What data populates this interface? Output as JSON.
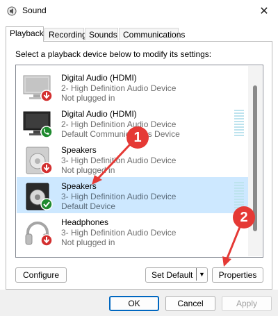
{
  "window": {
    "title": "Sound",
    "close_glyph": "✕"
  },
  "tabs": [
    {
      "label": "Playback",
      "active": true
    },
    {
      "label": "Recording",
      "active": false
    },
    {
      "label": "Sounds",
      "active": false
    },
    {
      "label": "Communications",
      "active": false
    }
  ],
  "instructions": "Select a playback device below to modify its settings:",
  "devices": [
    {
      "name": "Digital Audio (HDMI)",
      "description": "2- High Definition Audio Device",
      "status": "Not plugged in",
      "icon": "monitor-icon",
      "badge": "not-plugged-in-badge",
      "selected": false
    },
    {
      "name": "Digital Audio (HDMI)",
      "description": "2- High Definition Audio Device",
      "status": "Default Communications Device",
      "icon": "monitor-icon",
      "badge": "phone-badge",
      "selected": false
    },
    {
      "name": "Speakers",
      "description": "3- High Definition Audio Device",
      "status": "Not plugged in",
      "icon": "speaker-icon",
      "badge": "not-plugged-in-badge",
      "selected": false
    },
    {
      "name": "Speakers",
      "description": "3- High Definition Audio Device",
      "status": "Default Device",
      "icon": "speaker-icon",
      "badge": "default-check-badge",
      "selected": true
    },
    {
      "name": "Headphones",
      "description": "3- High Definition Audio Device",
      "status": "Not plugged in",
      "icon": "headphones-icon",
      "badge": "not-plugged-in-badge",
      "selected": false
    }
  ],
  "buttons": {
    "configure": "Configure",
    "set_default": "Set Default",
    "properties": "Properties",
    "ok": "OK",
    "cancel": "Cancel",
    "apply": "Apply"
  },
  "callouts": [
    "1",
    "2"
  ],
  "colors": {
    "selected_row": "#cde8ff",
    "callout": "#e53935",
    "default_badge": "#1e8a2e",
    "unplugged_badge": "#d32f2f"
  }
}
